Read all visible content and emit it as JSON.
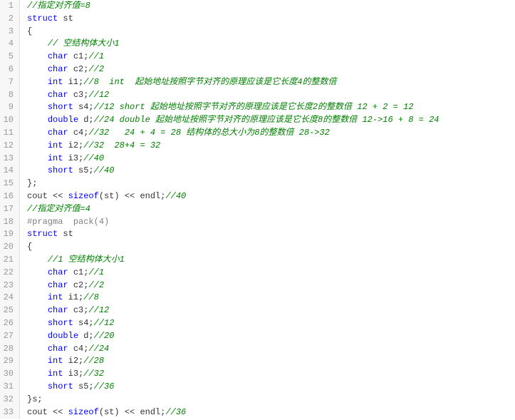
{
  "lines": [
    {
      "n": 1,
      "segments": [
        {
          "c": "cm",
          "t": "//指定对齐值=8"
        }
      ]
    },
    {
      "n": 2,
      "segments": [
        {
          "c": "kw",
          "t": "struct"
        },
        {
          "c": "pn",
          "t": " st"
        }
      ]
    },
    {
      "n": 3,
      "segments": [
        {
          "c": "pn",
          "t": "{"
        }
      ]
    },
    {
      "n": 4,
      "segments": [
        {
          "c": "pn",
          "t": "    "
        },
        {
          "c": "cm",
          "t": "// 空结构体大小1"
        }
      ]
    },
    {
      "n": 5,
      "segments": [
        {
          "c": "pn",
          "t": "    "
        },
        {
          "c": "kw",
          "t": "char"
        },
        {
          "c": "pn",
          "t": " c1;"
        },
        {
          "c": "cm",
          "t": "//1"
        }
      ]
    },
    {
      "n": 6,
      "segments": [
        {
          "c": "pn",
          "t": "    "
        },
        {
          "c": "kw",
          "t": "char"
        },
        {
          "c": "pn",
          "t": " c2;"
        },
        {
          "c": "cm",
          "t": "//2"
        }
      ]
    },
    {
      "n": 7,
      "segments": [
        {
          "c": "pn",
          "t": "    "
        },
        {
          "c": "kw",
          "t": "int"
        },
        {
          "c": "pn",
          "t": " i1;"
        },
        {
          "c": "cm",
          "t": "//8  int  起始地址按照字节对齐的原理应该是它长度4的整数倍"
        }
      ]
    },
    {
      "n": 8,
      "segments": [
        {
          "c": "pn",
          "t": "    "
        },
        {
          "c": "kw",
          "t": "char"
        },
        {
          "c": "pn",
          "t": " c3;"
        },
        {
          "c": "cm",
          "t": "//12"
        }
      ]
    },
    {
      "n": 9,
      "segments": [
        {
          "c": "pn",
          "t": "    "
        },
        {
          "c": "kw",
          "t": "short"
        },
        {
          "c": "pn",
          "t": " s4;"
        },
        {
          "c": "cm",
          "t": "//12 short 起始地址按照字节对齐的原理应该是它长度2的整数倍 12 + 2 = 12"
        }
      ]
    },
    {
      "n": 10,
      "segments": [
        {
          "c": "pn",
          "t": "    "
        },
        {
          "c": "kw",
          "t": "double"
        },
        {
          "c": "pn",
          "t": " d;"
        },
        {
          "c": "cm",
          "t": "//24 double 起始地址按照字节对齐的原理应该是它长度8的整数倍 12->16 + 8 = 24"
        }
      ]
    },
    {
      "n": 11,
      "segments": [
        {
          "c": "pn",
          "t": "    "
        },
        {
          "c": "kw",
          "t": "char"
        },
        {
          "c": "pn",
          "t": " c4;"
        },
        {
          "c": "cm",
          "t": "//32   24 + 4 = 28 结构体的总大小为8的整数倍 28->32"
        }
      ]
    },
    {
      "n": 12,
      "segments": [
        {
          "c": "pn",
          "t": "    "
        },
        {
          "c": "kw",
          "t": "int"
        },
        {
          "c": "pn",
          "t": " i2;"
        },
        {
          "c": "cm",
          "t": "//32  28+4 = 32"
        }
      ]
    },
    {
      "n": 13,
      "segments": [
        {
          "c": "pn",
          "t": "    "
        },
        {
          "c": "kw",
          "t": "int"
        },
        {
          "c": "pn",
          "t": " i3;"
        },
        {
          "c": "cm",
          "t": "//40"
        }
      ]
    },
    {
      "n": 14,
      "segments": [
        {
          "c": "pn",
          "t": "    "
        },
        {
          "c": "kw",
          "t": "short"
        },
        {
          "c": "pn",
          "t": " s5;"
        },
        {
          "c": "cm",
          "t": "//40"
        }
      ]
    },
    {
      "n": 15,
      "segments": [
        {
          "c": "pn",
          "t": "};"
        }
      ]
    },
    {
      "n": 16,
      "segments": [
        {
          "c": "pn",
          "t": "cout << "
        },
        {
          "c": "kw",
          "t": "sizeof"
        },
        {
          "c": "pn",
          "t": "(st) << endl;"
        },
        {
          "c": "cm",
          "t": "//40"
        }
      ]
    },
    {
      "n": 17,
      "segments": [
        {
          "c": "cm",
          "t": "//指定对齐值=4"
        }
      ]
    },
    {
      "n": 18,
      "segments": [
        {
          "c": "pp",
          "t": "#pragma  pack(4)"
        }
      ]
    },
    {
      "n": 19,
      "segments": [
        {
          "c": "kw",
          "t": "struct"
        },
        {
          "c": "pn",
          "t": " st"
        }
      ]
    },
    {
      "n": 20,
      "segments": [
        {
          "c": "pn",
          "t": "{"
        }
      ]
    },
    {
      "n": 21,
      "segments": [
        {
          "c": "pn",
          "t": "    "
        },
        {
          "c": "cm",
          "t": "//1 空结构体大小1"
        }
      ]
    },
    {
      "n": 22,
      "segments": [
        {
          "c": "pn",
          "t": "    "
        },
        {
          "c": "kw",
          "t": "char"
        },
        {
          "c": "pn",
          "t": " c1;"
        },
        {
          "c": "cm",
          "t": "//1"
        }
      ]
    },
    {
      "n": 23,
      "segments": [
        {
          "c": "pn",
          "t": "    "
        },
        {
          "c": "kw",
          "t": "char"
        },
        {
          "c": "pn",
          "t": " c2;"
        },
        {
          "c": "cm",
          "t": "//2"
        }
      ]
    },
    {
      "n": 24,
      "segments": [
        {
          "c": "pn",
          "t": "    "
        },
        {
          "c": "kw",
          "t": "int"
        },
        {
          "c": "pn",
          "t": " i1;"
        },
        {
          "c": "cm",
          "t": "//8"
        }
      ]
    },
    {
      "n": 25,
      "segments": [
        {
          "c": "pn",
          "t": "    "
        },
        {
          "c": "kw",
          "t": "char"
        },
        {
          "c": "pn",
          "t": " c3;"
        },
        {
          "c": "cm",
          "t": "//12"
        }
      ]
    },
    {
      "n": 26,
      "segments": [
        {
          "c": "pn",
          "t": "    "
        },
        {
          "c": "kw",
          "t": "short"
        },
        {
          "c": "pn",
          "t": " s4;"
        },
        {
          "c": "cm",
          "t": "//12"
        }
      ]
    },
    {
      "n": 27,
      "segments": [
        {
          "c": "pn",
          "t": "    "
        },
        {
          "c": "kw",
          "t": "double"
        },
        {
          "c": "pn",
          "t": " d;"
        },
        {
          "c": "cm",
          "t": "//20"
        }
      ]
    },
    {
      "n": 28,
      "segments": [
        {
          "c": "pn",
          "t": "    "
        },
        {
          "c": "kw",
          "t": "char"
        },
        {
          "c": "pn",
          "t": " c4;"
        },
        {
          "c": "cm",
          "t": "//24"
        }
      ]
    },
    {
      "n": 29,
      "segments": [
        {
          "c": "pn",
          "t": "    "
        },
        {
          "c": "kw",
          "t": "int"
        },
        {
          "c": "pn",
          "t": " i2;"
        },
        {
          "c": "cm",
          "t": "//28"
        }
      ]
    },
    {
      "n": 30,
      "segments": [
        {
          "c": "pn",
          "t": "    "
        },
        {
          "c": "kw",
          "t": "int"
        },
        {
          "c": "pn",
          "t": " i3;"
        },
        {
          "c": "cm",
          "t": "//32"
        }
      ]
    },
    {
      "n": 31,
      "segments": [
        {
          "c": "pn",
          "t": "    "
        },
        {
          "c": "kw",
          "t": "short"
        },
        {
          "c": "pn",
          "t": " s5;"
        },
        {
          "c": "cm",
          "t": "//36"
        }
      ]
    },
    {
      "n": 32,
      "segments": [
        {
          "c": "pn",
          "t": "}s;"
        }
      ]
    },
    {
      "n": 33,
      "segments": [
        {
          "c": "pn",
          "t": "cout << "
        },
        {
          "c": "kw",
          "t": "sizeof"
        },
        {
          "c": "pn",
          "t": "(st) << endl;"
        },
        {
          "c": "cm",
          "t": "//36"
        }
      ]
    }
  ]
}
